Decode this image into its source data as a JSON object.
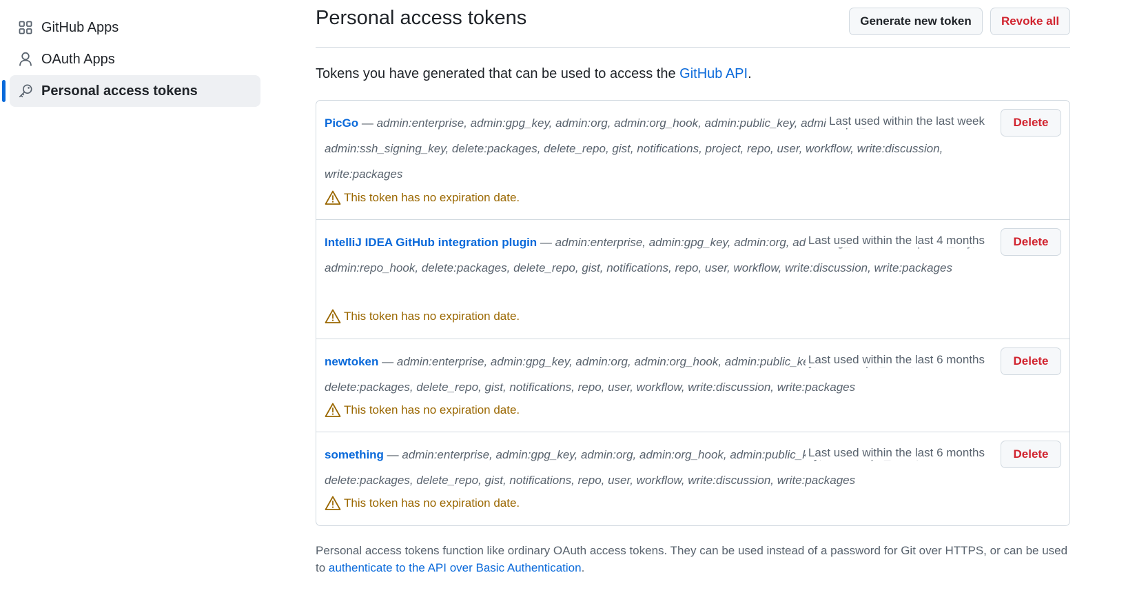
{
  "sidebar": {
    "items": [
      {
        "label": "GitHub Apps",
        "icon": "apps-icon",
        "active": false
      },
      {
        "label": "OAuth Apps",
        "icon": "person-icon",
        "active": false
      },
      {
        "label": "Personal access tokens",
        "icon": "key-icon",
        "active": true
      }
    ]
  },
  "header": {
    "title": "Personal access tokens",
    "generate_label": "Generate new token",
    "revoke_label": "Revoke all"
  },
  "intro": {
    "text": "Tokens you have generated that can be used to access the ",
    "link": "GitHub API",
    "end": "."
  },
  "tokens": [
    {
      "name": "PicGo",
      "dash": " — ",
      "scopes": "admin:enterprise, admin:gpg_key, admin:org, admin:org_hook, admin:public_key, admin:repo_hook, admin:ssh_signing_key, delete:packages, delete_repo, gist, notifications, project, repo, user, workflow, write:discussion, write:packages",
      "last_used": "Last used within the last week",
      "delete_label": "Delete",
      "warning": "This token has no expiration date."
    },
    {
      "name": "IntelliJ IDEA GitHub integration plugin",
      "dash": " — ",
      "scopes": "admin:enterprise, admin:gpg_key, admin:org, admin:org_hook, admin:public_key, admin:repo_hook, delete:packages, delete_repo, gist, notifications, repo, user, workflow, write:discussion, write:packages",
      "last_used": "Last used within the last 4 months",
      "delete_label": "Delete",
      "warning": "This token has no expiration date."
    },
    {
      "name": "newtoken",
      "dash": " — ",
      "scopes": "admin:enterprise, admin:gpg_key, admin:org, admin:org_hook, admin:public_key, admin:repo_hook, delete:packages, delete_repo, gist, notifications, repo, user, workflow, write:discussion, write:packages",
      "last_used": "Last used within the last 6 months",
      "delete_label": "Delete",
      "warning": "This token has no expiration date."
    },
    {
      "name": "something",
      "dash": " — ",
      "scopes": "admin:enterprise, admin:gpg_key, admin:org, admin:org_hook, admin:public_key, admin:repo_hook, delete:packages, delete_repo, gist, notifications, repo, user, workflow, write:discussion, write:packages",
      "last_used": "Last used within the last 6 months",
      "delete_label": "Delete",
      "warning": "This token has no expiration date."
    }
  ],
  "footer": {
    "text": "Personal access tokens function like ordinary OAuth access tokens. They can be used instead of a password for Git over HTTPS, or can be used to ",
    "link": "authenticate to the API over Basic Authentication",
    "end": "."
  },
  "colors": {
    "accent": "#0969da",
    "danger": "#d1242f",
    "warning": "#9a6700"
  }
}
